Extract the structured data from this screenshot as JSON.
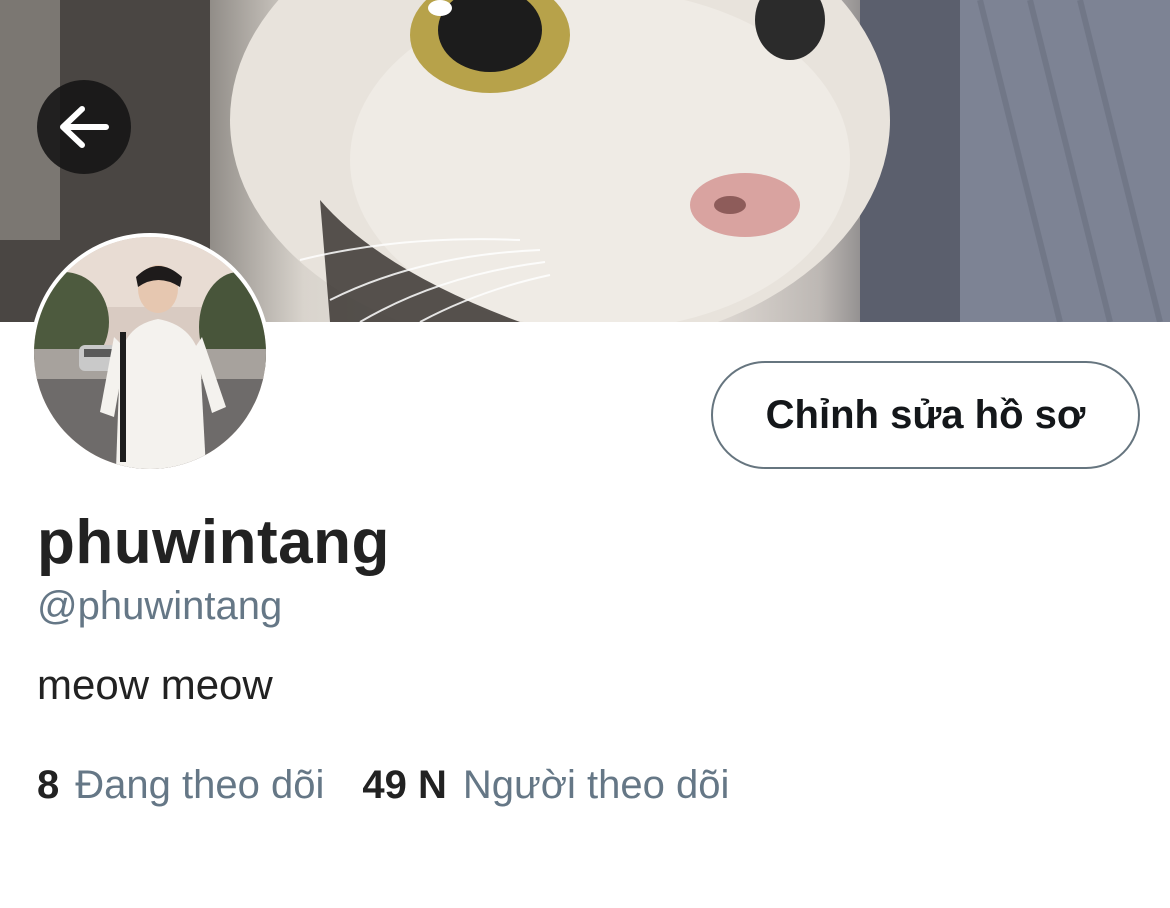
{
  "header": {
    "back_label": "Back"
  },
  "profile": {
    "edit_button": "Chỉnh sửa hồ sơ",
    "display_name": "phuwintang",
    "handle": "@phuwintang",
    "bio": "meow meow"
  },
  "stats": {
    "following_count": "8",
    "following_label": "Đang theo dõi",
    "followers_count": "49 N",
    "followers_label": "Người theo dõi"
  },
  "icons": {
    "back": "arrow-left-icon"
  },
  "colors": {
    "text_primary": "#222222",
    "text_secondary": "#657786",
    "button_border": "#66757f",
    "back_button_bg": "#141414"
  }
}
